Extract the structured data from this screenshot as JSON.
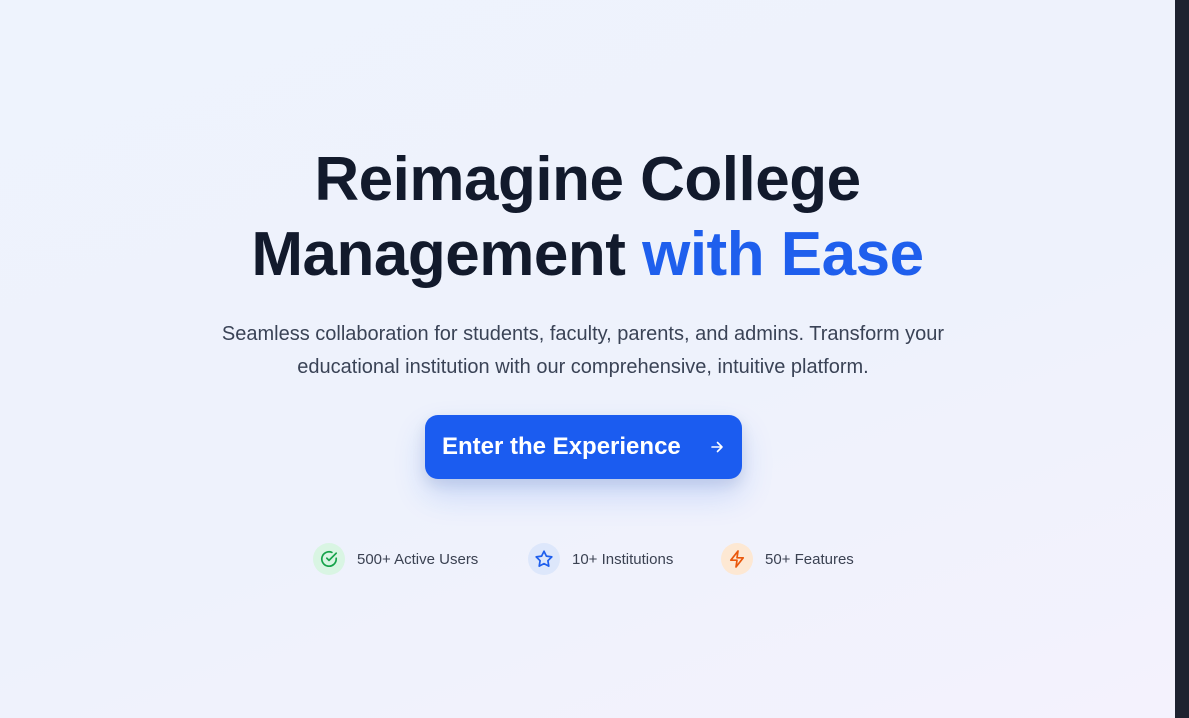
{
  "hero": {
    "title_line1": "Reimagine College",
    "title_line2_plain": "Management ",
    "title_line2_accent": "with Ease",
    "subtitle": "Seamless collaboration for students, faculty, parents, and admins. Transform your educational institution with our comprehensive, intuitive platform."
  },
  "cta": {
    "label": "Enter the Experience",
    "icon": "arrow-right-icon"
  },
  "stats": [
    {
      "label": "500+ Active Users",
      "icon": "check-circle-icon",
      "color": "#16a34a",
      "bg": "#d9f5e3"
    },
    {
      "label": "10+ Institutions",
      "icon": "star-icon",
      "color": "#1f5fed",
      "bg": "#dde7fb"
    },
    {
      "label": "50+ Features",
      "icon": "lightning-icon",
      "color": "#ea580c",
      "bg": "#fde8d3"
    }
  ],
  "colors": {
    "accent": "#1f5fed",
    "heading": "#121a2c",
    "button": "#1b5cf0"
  }
}
